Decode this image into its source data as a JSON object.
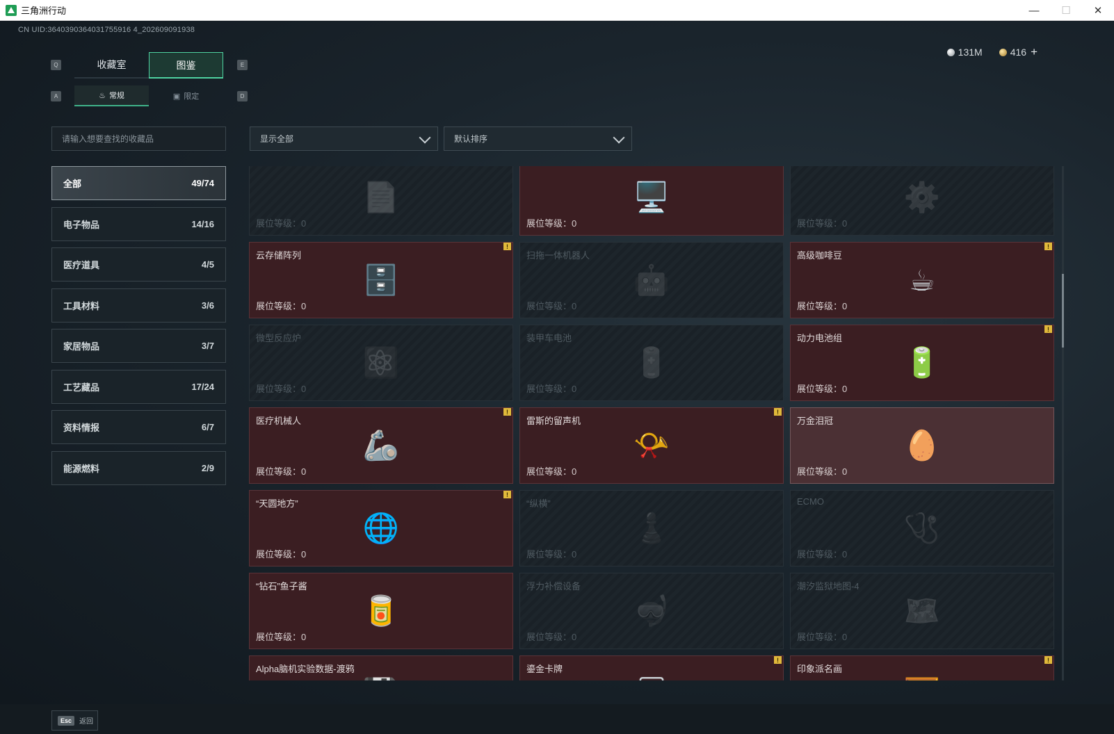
{
  "window": {
    "title": "三角洲行动"
  },
  "header": {
    "uid": "CN UID:3640390364031755916 4_202609091938",
    "currency": {
      "silver": "131M",
      "gold": "416"
    }
  },
  "keys": {
    "q": "Q",
    "e": "E",
    "a": "A",
    "d": "D"
  },
  "tabs": {
    "collection_room": "收藏室",
    "codex": "图鉴"
  },
  "subtabs": {
    "regular": "常规",
    "limited": "限定"
  },
  "search": {
    "placeholder": "请输入想要查找的收藏品"
  },
  "filters": {
    "show": "显示全部",
    "sort": "默认排序"
  },
  "categories": [
    {
      "label": "全部",
      "count": "49/74"
    },
    {
      "label": "电子物品",
      "count": "14/16"
    },
    {
      "label": "医疗道具",
      "count": "4/5"
    },
    {
      "label": "工具材料",
      "count": "3/6"
    },
    {
      "label": "家居物品",
      "count": "3/7"
    },
    {
      "label": "工艺藏品",
      "count": "17/24"
    },
    {
      "label": "资料情报",
      "count": "6/7"
    },
    {
      "label": "能源燃料",
      "count": "2/9"
    }
  ],
  "level_label": "展位等级：0",
  "items": [
    {
      "name": "",
      "icon": "📄"
    },
    {
      "name": "",
      "icon": "🖥️"
    },
    {
      "name": "",
      "icon": "⚙️"
    },
    {
      "name": "云存储阵列",
      "icon": "🗄️"
    },
    {
      "name": "扫拖一体机器人",
      "icon": "🤖"
    },
    {
      "name": "高级咖啡豆",
      "icon": "☕"
    },
    {
      "name": "微型反应炉",
      "icon": "⚛️"
    },
    {
      "name": "装甲车电池",
      "icon": "🔋"
    },
    {
      "name": "动力电池组",
      "icon": "🔋"
    },
    {
      "name": "医疗机械人",
      "icon": "🦾"
    },
    {
      "name": "雷斯的留声机",
      "icon": "📯"
    },
    {
      "name": "万金泪冠",
      "icon": "🥚"
    },
    {
      "name": "“天圆地方”",
      "icon": "🌐"
    },
    {
      "name": "“纵横”",
      "icon": "♟️"
    },
    {
      "name": "ECMO",
      "icon": "🩺"
    },
    {
      "name": "“钻石”鱼子酱",
      "icon": "🥫"
    },
    {
      "name": "浮力补偿设备",
      "icon": "🤿"
    },
    {
      "name": "潮汐监狱地图-4",
      "icon": "🗺️"
    },
    {
      "name": "Alpha脑机实验数据-渡鸦",
      "icon": "💾"
    },
    {
      "name": "鎏金卡牌",
      "icon": "🃏"
    },
    {
      "name": "印象派名画",
      "icon": "🖼️"
    }
  ],
  "footer": {
    "esc_key": "Esc",
    "back": "返回"
  }
}
